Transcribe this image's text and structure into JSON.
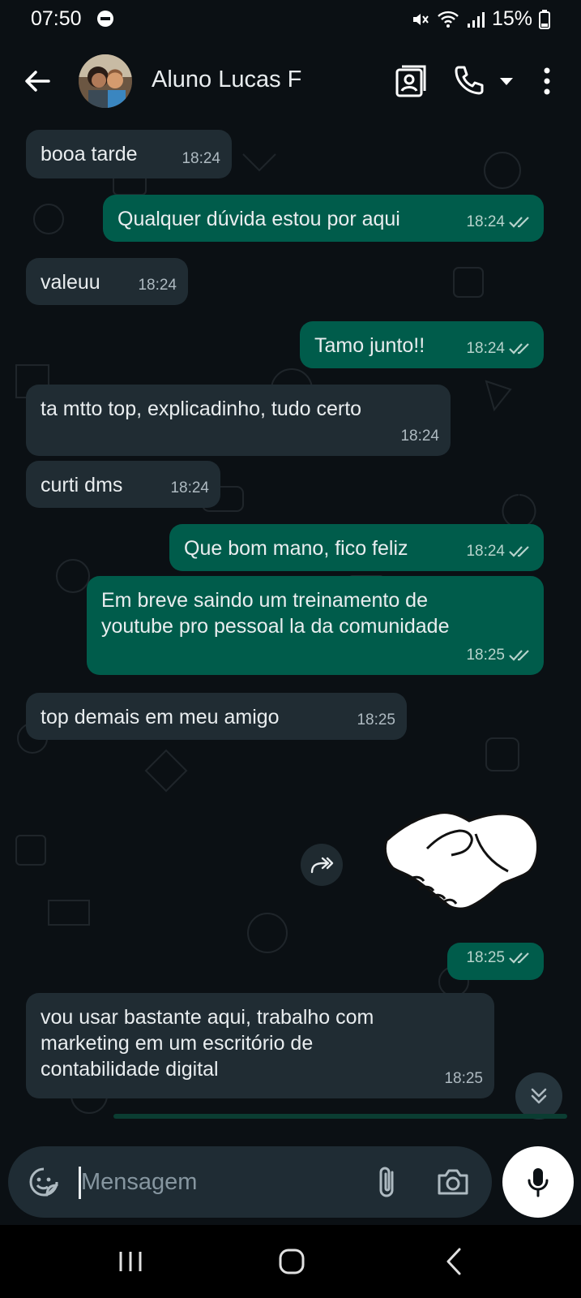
{
  "status_bar": {
    "time": "07:50",
    "battery": "15%"
  },
  "header": {
    "contact_name": "Aluno Lucas F"
  },
  "messages": [
    {
      "direction": "in",
      "text": "booa tarde",
      "time": "18:24"
    },
    {
      "direction": "out",
      "text": "Qualquer dúvida estou por aqui",
      "time": "18:24",
      "status": "read"
    },
    {
      "direction": "in",
      "text": "valeuu",
      "time": "18:24"
    },
    {
      "direction": "out",
      "text": "Tamo junto!!",
      "time": "18:24",
      "status": "read"
    },
    {
      "direction": "in",
      "text": "ta mtto top, explicadinho, tudo  certo",
      "time": "18:24"
    },
    {
      "direction": "in",
      "text": "curti dms",
      "time": "18:24"
    },
    {
      "direction": "out",
      "text": "Que bom mano, fico feliz",
      "time": "18:24",
      "status": "read"
    },
    {
      "direction": "out",
      "text": "Em breve saindo um treinamento de youtube pro pessoal la da comunidade",
      "time": "18:25",
      "status": "read"
    },
    {
      "direction": "in",
      "text": "top demais em meu amigo",
      "time": "18:25"
    },
    {
      "direction": "out",
      "type": "sticker",
      "sticker": "handshake",
      "time": "18:25",
      "status": "read"
    },
    {
      "direction": "in",
      "text": "vou usar bastante aqui, trabalho com marketing em um escritório de contabilidade digital",
      "time": "18:25"
    }
  ],
  "composer": {
    "placeholder": "Mensagem"
  },
  "icons": {
    "back": "arrow-left-icon",
    "contacts": "contact-card-icon",
    "call": "phone-icon",
    "more": "more-vertical-icon",
    "emoji": "sticker-emoji-icon",
    "attach": "paperclip-icon",
    "camera": "camera-icon",
    "mic": "microphone-icon",
    "forward": "forward-icon",
    "scroll": "chevrons-down-icon"
  },
  "colors": {
    "background": "#0b1014",
    "incoming_bubble": "#202c33",
    "outgoing_bubble": "#005c4b",
    "read_tick": "#b7d3cc"
  }
}
